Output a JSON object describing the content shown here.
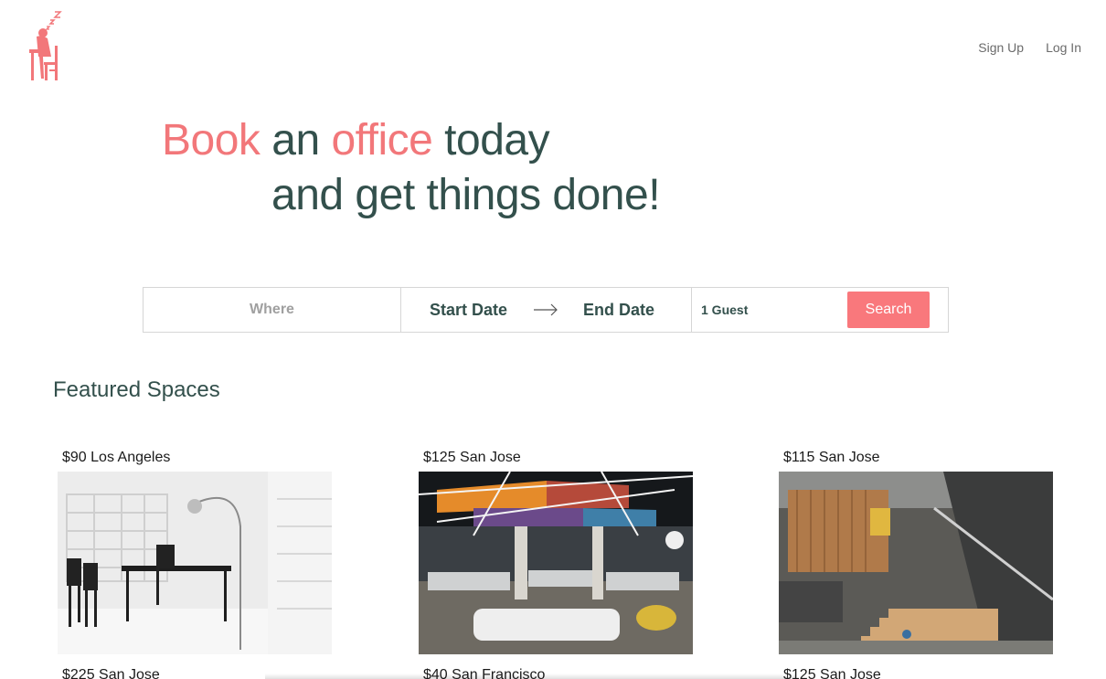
{
  "header": {
    "logo_icon": "sleeping-worker-logo-icon",
    "brand_color": "#f2777a",
    "nav": {
      "signup_label": "Sign Up",
      "login_label": "Log In"
    }
  },
  "hero": {
    "word1": "Book",
    "word2": " an ",
    "word3": "office",
    "word4": " today",
    "line2": "and get things done!"
  },
  "search": {
    "where_placeholder": "Where",
    "start_date_label": "Start Date",
    "arrow_icon": "arrow-right-icon",
    "end_date_label": "End Date",
    "guests_label": "1 Guest",
    "button_label": "Search",
    "button_color": "#f9787c"
  },
  "featured": {
    "title": "Featured Spaces",
    "spaces": [
      {
        "price": "$90",
        "city": "Los Angeles"
      },
      {
        "price": "$125",
        "city": "San Jose"
      },
      {
        "price": "$115",
        "city": "San Jose"
      },
      {
        "price": "$225",
        "city": "San Jose"
      },
      {
        "price": "$40",
        "city": "San Francisco"
      },
      {
        "price": "$125",
        "city": "San Jose"
      }
    ]
  }
}
